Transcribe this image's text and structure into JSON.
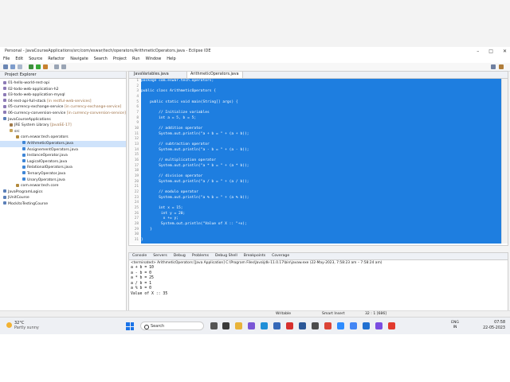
{
  "window": {
    "title": "Personal - JavaCourseApplications/src/com/eswar/tech/operators/ArithmeticOperators.java - Eclipse IDE",
    "minimize": "–",
    "maximize": "□",
    "close": "✕"
  },
  "menu": [
    "File",
    "Edit",
    "Source",
    "Refactor",
    "Navigate",
    "Search",
    "Project",
    "Run",
    "Window",
    "Help"
  ],
  "explorer": {
    "title": "Project Explorer",
    "items": [
      {
        "label": "01-hello-world-rest-api",
        "sub": ""
      },
      {
        "label": "02-todo-web-application-h2",
        "sub": ""
      },
      {
        "label": "03-todo-web-application-mysql",
        "sub": ""
      },
      {
        "label": "04-rest-api-full-stack",
        "sub": "[in restful-web-services]"
      },
      {
        "label": "05-currency-exchange-service",
        "sub": "[in currency-exchange-service]"
      },
      {
        "label": "06-currency-conversion-service",
        "sub": "[in currency-conversion-service]"
      },
      {
        "label": "JavaCourseApplications",
        "sub": ""
      },
      {
        "label": "JRE System Library",
        "sub": "[JavaSE-17]"
      },
      {
        "label": "src",
        "sub": ""
      },
      {
        "label": "com.eswar.tech.operators",
        "sub": ""
      },
      {
        "label": "ArithmeticOperators.java",
        "sub": ""
      },
      {
        "label": "AssignementOperators.java",
        "sub": ""
      },
      {
        "label": "InstanceOperator.java",
        "sub": ""
      },
      {
        "label": "LogicalOperators.java",
        "sub": ""
      },
      {
        "label": "RelationalOperators.java",
        "sub": ""
      },
      {
        "label": "TernaryOperator.java",
        "sub": ""
      },
      {
        "label": "UnaryOperators.java",
        "sub": ""
      },
      {
        "label": "com.eswar.tech.core",
        "sub": ""
      },
      {
        "label": "JavaProgramLogics",
        "sub": ""
      },
      {
        "label": "JUnitCourse",
        "sub": ""
      },
      {
        "label": "MockitoTestingCourse",
        "sub": ""
      }
    ]
  },
  "editor": {
    "tabs": [
      "JavaVariables.java",
      "ArithmeticOperators.java"
    ],
    "line_numbers": [
      "1",
      "2",
      "3",
      "4",
      "5",
      "6",
      "7",
      "8",
      "9",
      "10",
      "11",
      "12",
      "13",
      "14",
      "15",
      "16",
      "17",
      "18",
      "19",
      "20",
      "21",
      "22",
      "23",
      "24",
      "25",
      "26",
      "27",
      "28",
      "29",
      "30",
      "31"
    ],
    "code": [
      "package com.eswar.tech.operators;",
      "",
      "public class ArithmeticOperators {",
      "",
      "    public static void main(String[] args) {",
      "",
      "        // Initialize variables",
      "        int a = 5, b = 5;",
      "",
      "        // addition operator",
      "        System.out.println(\"a + b = \" + (a + b));",
      "",
      "        // subtraction operator",
      "        System.out.println(\"a - b = \" + (a - b));",
      "",
      "        // multiplication operator",
      "        System.out.println(\"a * b = \" + (a * b));",
      "",
      "        // division operator",
      "        System.out.println(\"a / b = \" + (a / b));",
      "",
      "        // modulo operator",
      "        System.out.println(\"a % b = \" + (a % b));",
      "",
      "        int x = 15;",
      "         int y = 20;",
      "          x += y;",
      "         System.out.println(\"Value of X :: \"+x);",
      "    }",
      "",
      "}"
    ]
  },
  "console": {
    "tabs": [
      "Console",
      "Servers",
      "Debug",
      "Problems",
      "Debug Shell",
      "Breakpoints",
      "Coverage"
    ],
    "header": "<terminated> ArithmeticOperators [Java Application] C:\\Program Files\\Java\\jdk-11.0.17\\bin\\javaw.exe  (22-May-2023, 7:58:23 am – 7:58:24 am)",
    "output": [
      "a + b = 10",
      "a - b = 0",
      "a * b = 25",
      "a / b = 1",
      "a % b = 0",
      "Value of X :: 35"
    ]
  },
  "status": {
    "mode": "Writable",
    "insert": "Smart Insert",
    "position": "32 : 1 [686]"
  },
  "taskbar": {
    "temperature": "32°C",
    "weather": "Partly sunny",
    "search": "Search",
    "language": "ENG",
    "region": "IN",
    "time": "07:58",
    "date": "22-05-2023"
  },
  "colors": {
    "selection": "#1e7ee0",
    "accent": "#1a73e8"
  }
}
